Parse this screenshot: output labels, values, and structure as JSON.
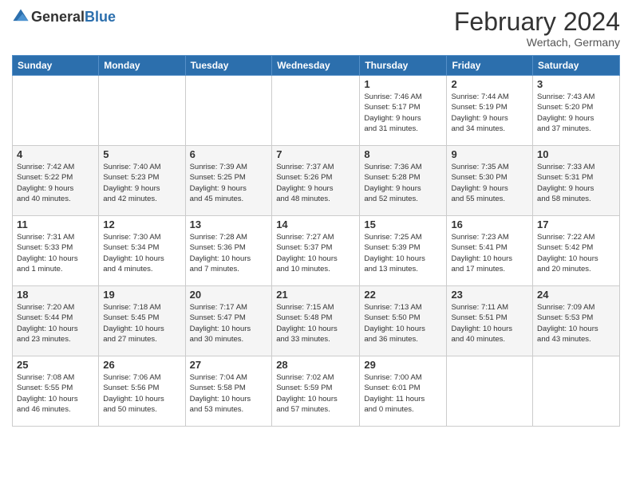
{
  "header": {
    "logo": {
      "general": "General",
      "blue": "Blue"
    },
    "title": "February 2024",
    "subtitle": "Wertach, Germany"
  },
  "calendar": {
    "days_of_week": [
      "Sunday",
      "Monday",
      "Tuesday",
      "Wednesday",
      "Thursday",
      "Friday",
      "Saturday"
    ],
    "weeks": [
      [
        {
          "day": "",
          "info": ""
        },
        {
          "day": "",
          "info": ""
        },
        {
          "day": "",
          "info": ""
        },
        {
          "day": "",
          "info": ""
        },
        {
          "day": "1",
          "info": "Sunrise: 7:46 AM\nSunset: 5:17 PM\nDaylight: 9 hours\nand 31 minutes."
        },
        {
          "day": "2",
          "info": "Sunrise: 7:44 AM\nSunset: 5:19 PM\nDaylight: 9 hours\nand 34 minutes."
        },
        {
          "day": "3",
          "info": "Sunrise: 7:43 AM\nSunset: 5:20 PM\nDaylight: 9 hours\nand 37 minutes."
        }
      ],
      [
        {
          "day": "4",
          "info": "Sunrise: 7:42 AM\nSunset: 5:22 PM\nDaylight: 9 hours\nand 40 minutes."
        },
        {
          "day": "5",
          "info": "Sunrise: 7:40 AM\nSunset: 5:23 PM\nDaylight: 9 hours\nand 42 minutes."
        },
        {
          "day": "6",
          "info": "Sunrise: 7:39 AM\nSunset: 5:25 PM\nDaylight: 9 hours\nand 45 minutes."
        },
        {
          "day": "7",
          "info": "Sunrise: 7:37 AM\nSunset: 5:26 PM\nDaylight: 9 hours\nand 48 minutes."
        },
        {
          "day": "8",
          "info": "Sunrise: 7:36 AM\nSunset: 5:28 PM\nDaylight: 9 hours\nand 52 minutes."
        },
        {
          "day": "9",
          "info": "Sunrise: 7:35 AM\nSunset: 5:30 PM\nDaylight: 9 hours\nand 55 minutes."
        },
        {
          "day": "10",
          "info": "Sunrise: 7:33 AM\nSunset: 5:31 PM\nDaylight: 9 hours\nand 58 minutes."
        }
      ],
      [
        {
          "day": "11",
          "info": "Sunrise: 7:31 AM\nSunset: 5:33 PM\nDaylight: 10 hours\nand 1 minute."
        },
        {
          "day": "12",
          "info": "Sunrise: 7:30 AM\nSunset: 5:34 PM\nDaylight: 10 hours\nand 4 minutes."
        },
        {
          "day": "13",
          "info": "Sunrise: 7:28 AM\nSunset: 5:36 PM\nDaylight: 10 hours\nand 7 minutes."
        },
        {
          "day": "14",
          "info": "Sunrise: 7:27 AM\nSunset: 5:37 PM\nDaylight: 10 hours\nand 10 minutes."
        },
        {
          "day": "15",
          "info": "Sunrise: 7:25 AM\nSunset: 5:39 PM\nDaylight: 10 hours\nand 13 minutes."
        },
        {
          "day": "16",
          "info": "Sunrise: 7:23 AM\nSunset: 5:41 PM\nDaylight: 10 hours\nand 17 minutes."
        },
        {
          "day": "17",
          "info": "Sunrise: 7:22 AM\nSunset: 5:42 PM\nDaylight: 10 hours\nand 20 minutes."
        }
      ],
      [
        {
          "day": "18",
          "info": "Sunrise: 7:20 AM\nSunset: 5:44 PM\nDaylight: 10 hours\nand 23 minutes."
        },
        {
          "day": "19",
          "info": "Sunrise: 7:18 AM\nSunset: 5:45 PM\nDaylight: 10 hours\nand 27 minutes."
        },
        {
          "day": "20",
          "info": "Sunrise: 7:17 AM\nSunset: 5:47 PM\nDaylight: 10 hours\nand 30 minutes."
        },
        {
          "day": "21",
          "info": "Sunrise: 7:15 AM\nSunset: 5:48 PM\nDaylight: 10 hours\nand 33 minutes."
        },
        {
          "day": "22",
          "info": "Sunrise: 7:13 AM\nSunset: 5:50 PM\nDaylight: 10 hours\nand 36 minutes."
        },
        {
          "day": "23",
          "info": "Sunrise: 7:11 AM\nSunset: 5:51 PM\nDaylight: 10 hours\nand 40 minutes."
        },
        {
          "day": "24",
          "info": "Sunrise: 7:09 AM\nSunset: 5:53 PM\nDaylight: 10 hours\nand 43 minutes."
        }
      ],
      [
        {
          "day": "25",
          "info": "Sunrise: 7:08 AM\nSunset: 5:55 PM\nDaylight: 10 hours\nand 46 minutes."
        },
        {
          "day": "26",
          "info": "Sunrise: 7:06 AM\nSunset: 5:56 PM\nDaylight: 10 hours\nand 50 minutes."
        },
        {
          "day": "27",
          "info": "Sunrise: 7:04 AM\nSunset: 5:58 PM\nDaylight: 10 hours\nand 53 minutes."
        },
        {
          "day": "28",
          "info": "Sunrise: 7:02 AM\nSunset: 5:59 PM\nDaylight: 10 hours\nand 57 minutes."
        },
        {
          "day": "29",
          "info": "Sunrise: 7:00 AM\nSunset: 6:01 PM\nDaylight: 11 hours\nand 0 minutes."
        },
        {
          "day": "",
          "info": ""
        },
        {
          "day": "",
          "info": ""
        }
      ]
    ]
  }
}
